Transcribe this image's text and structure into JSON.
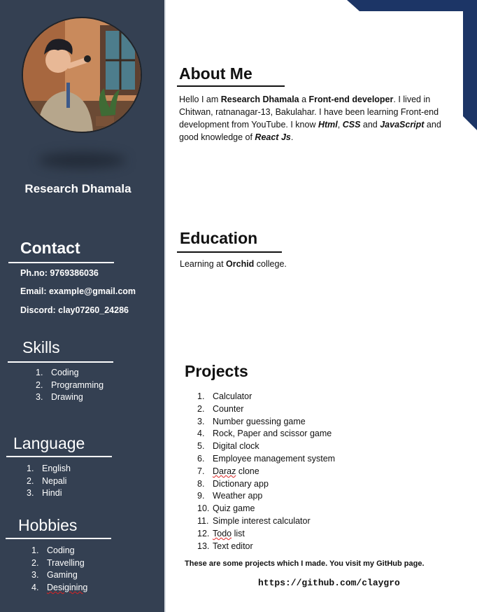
{
  "profile": {
    "name": "Research Dhamala"
  },
  "contact": {
    "heading": "Contact",
    "phone": "Ph.no: 9769386036",
    "email": "Email: example@gmail.com",
    "discord": "Discord: clay07260_24286"
  },
  "skills": {
    "heading": "Skills",
    "items": [
      {
        "num": "1.",
        "label": "Coding"
      },
      {
        "num": "2.",
        "label": "Programming"
      },
      {
        "num": "3.",
        "label": "Drawing"
      }
    ]
  },
  "language": {
    "heading": "Language",
    "items": [
      {
        "num": "1.",
        "label": "English"
      },
      {
        "num": "2.",
        "label": "Nepali"
      },
      {
        "num": "3.",
        "label": "Hindi"
      }
    ]
  },
  "hobbies": {
    "heading": "Hobbies",
    "items": [
      {
        "num": "1.",
        "label": "Coding"
      },
      {
        "num": "2.",
        "label": "Travelling"
      },
      {
        "num": "3.",
        "label": "Gaming"
      },
      {
        "num": "4.",
        "label": "Desigining"
      }
    ]
  },
  "about": {
    "heading": "About Me",
    "p1": "Hello I am ",
    "name": "Research Dhamala",
    "p2": " a ",
    "role": "Front-end developer",
    "p3": ". I lived in Chitwan, ratnanagar-13, Bakulahar. I have been learning Front-end development from YouTube. I know ",
    "html": "Html",
    "c1": ", ",
    "css": "CSS",
    "and1": " and ",
    "js": "JavaScript",
    "p4": " and good knowledge of ",
    "react": "React Js",
    "end": "."
  },
  "education": {
    "heading": "Education",
    "p1": "Learning at ",
    "college": "Orchid",
    "p2": " college."
  },
  "projects": {
    "heading": "Projects",
    "items": [
      {
        "num": "1.",
        "label": "Calculator"
      },
      {
        "num": "2.",
        "label": "Counter"
      },
      {
        "num": "3.",
        "label": "Number guessing game"
      },
      {
        "num": "4.",
        "label": "Rock, Paper and scissor game"
      },
      {
        "num": "5.",
        "label": "Digital clock"
      },
      {
        "num": "6.",
        "label": "Employee management system"
      },
      {
        "num": "7.",
        "label_a": "Daraz",
        "label_b": " clone"
      },
      {
        "num": "8.",
        "label": "Dictionary app"
      },
      {
        "num": "9.",
        "label": "Weather app"
      },
      {
        "num": "10.",
        "label": "Quiz game"
      },
      {
        "num": "11.",
        "label": "Simple interest calculator"
      },
      {
        "num": "12.",
        "label_a": "Todo",
        "label_b": " list"
      },
      {
        "num": "13.",
        "label": "Text editor"
      }
    ],
    "note": "These are some projects which I made. You visit my GitHub page.",
    "link": "https://github.com/claygro"
  },
  "colors": {
    "sidebar": "#344052",
    "corner_accent": "#1c3566"
  }
}
